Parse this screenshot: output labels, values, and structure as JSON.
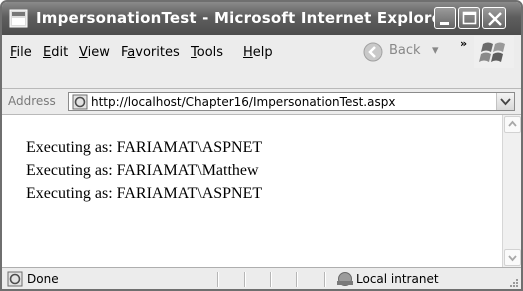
{
  "window": {
    "title": "ImpersonationTest - Microsoft Internet Explorer",
    "controls": [
      "minimize-icon",
      "maximize-icon",
      "close-icon"
    ]
  },
  "menubar": {
    "items": [
      {
        "label": "File",
        "underline": "F"
      },
      {
        "label": "Edit",
        "underline": "E"
      },
      {
        "label": "View",
        "underline": "V"
      },
      {
        "label": "Favorites",
        "underline": "a"
      },
      {
        "label": "Tools",
        "underline": "T"
      },
      {
        "label": "Help",
        "underline": "H"
      }
    ],
    "back_label": "Back",
    "overflow_label": "»"
  },
  "address": {
    "label": "Address",
    "url": "http://localhost/Chapter16/ImpersonationTest.aspx"
  },
  "content": {
    "lines": [
      "Executing as: FARIAMAT\\ASPNET",
      "Executing as: FARIAMAT\\Matthew",
      "Executing as: FARIAMAT\\ASPNET"
    ]
  },
  "status": {
    "text": "Done",
    "zone": "Local intranet"
  }
}
